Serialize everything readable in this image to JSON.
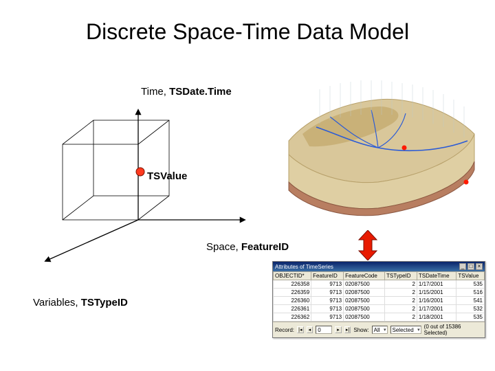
{
  "title": "Discrete Space-Time Data Model",
  "axes": {
    "time_label_prefix": "Time, ",
    "time_label_bold": "TSDate.Time",
    "tsvalue_label": "TSValue",
    "space_label_prefix": "Space, ",
    "space_label_bold": "FeatureID",
    "var_label_prefix": "Variables, ",
    "var_label_bold": "TSTypeID"
  },
  "attr_window": {
    "title": "Attributes of TimeSeries",
    "minimize": "_",
    "maximize": "□",
    "close": "×",
    "columns": [
      "OBJECTID*",
      "FeatureID",
      "FeatureCode",
      "TSTypeID",
      "TSDateTime",
      "TSValue"
    ],
    "rows": [
      [
        "226358",
        "9713",
        "02087500",
        "2",
        "1/17/2001",
        "535"
      ],
      [
        "226359",
        "9713",
        "02087500",
        "2",
        "1/15/2001",
        "516"
      ],
      [
        "226360",
        "9713",
        "02087500",
        "2",
        "1/16/2001",
        "541"
      ],
      [
        "226361",
        "9713",
        "02087500",
        "2",
        "1/17/2001",
        "532"
      ],
      [
        "226362",
        "9713",
        "02087500",
        "2",
        "1/18/2001",
        "535"
      ]
    ],
    "status": {
      "record_label": "Record:",
      "first": "|◂",
      "prev": "◂",
      "value": "0",
      "next": "▸",
      "last": "▸|",
      "show_label": "Show:",
      "show_all": "All",
      "selected_label": "Selected",
      "summary": "(0 out of 15386 Selected)"
    }
  }
}
